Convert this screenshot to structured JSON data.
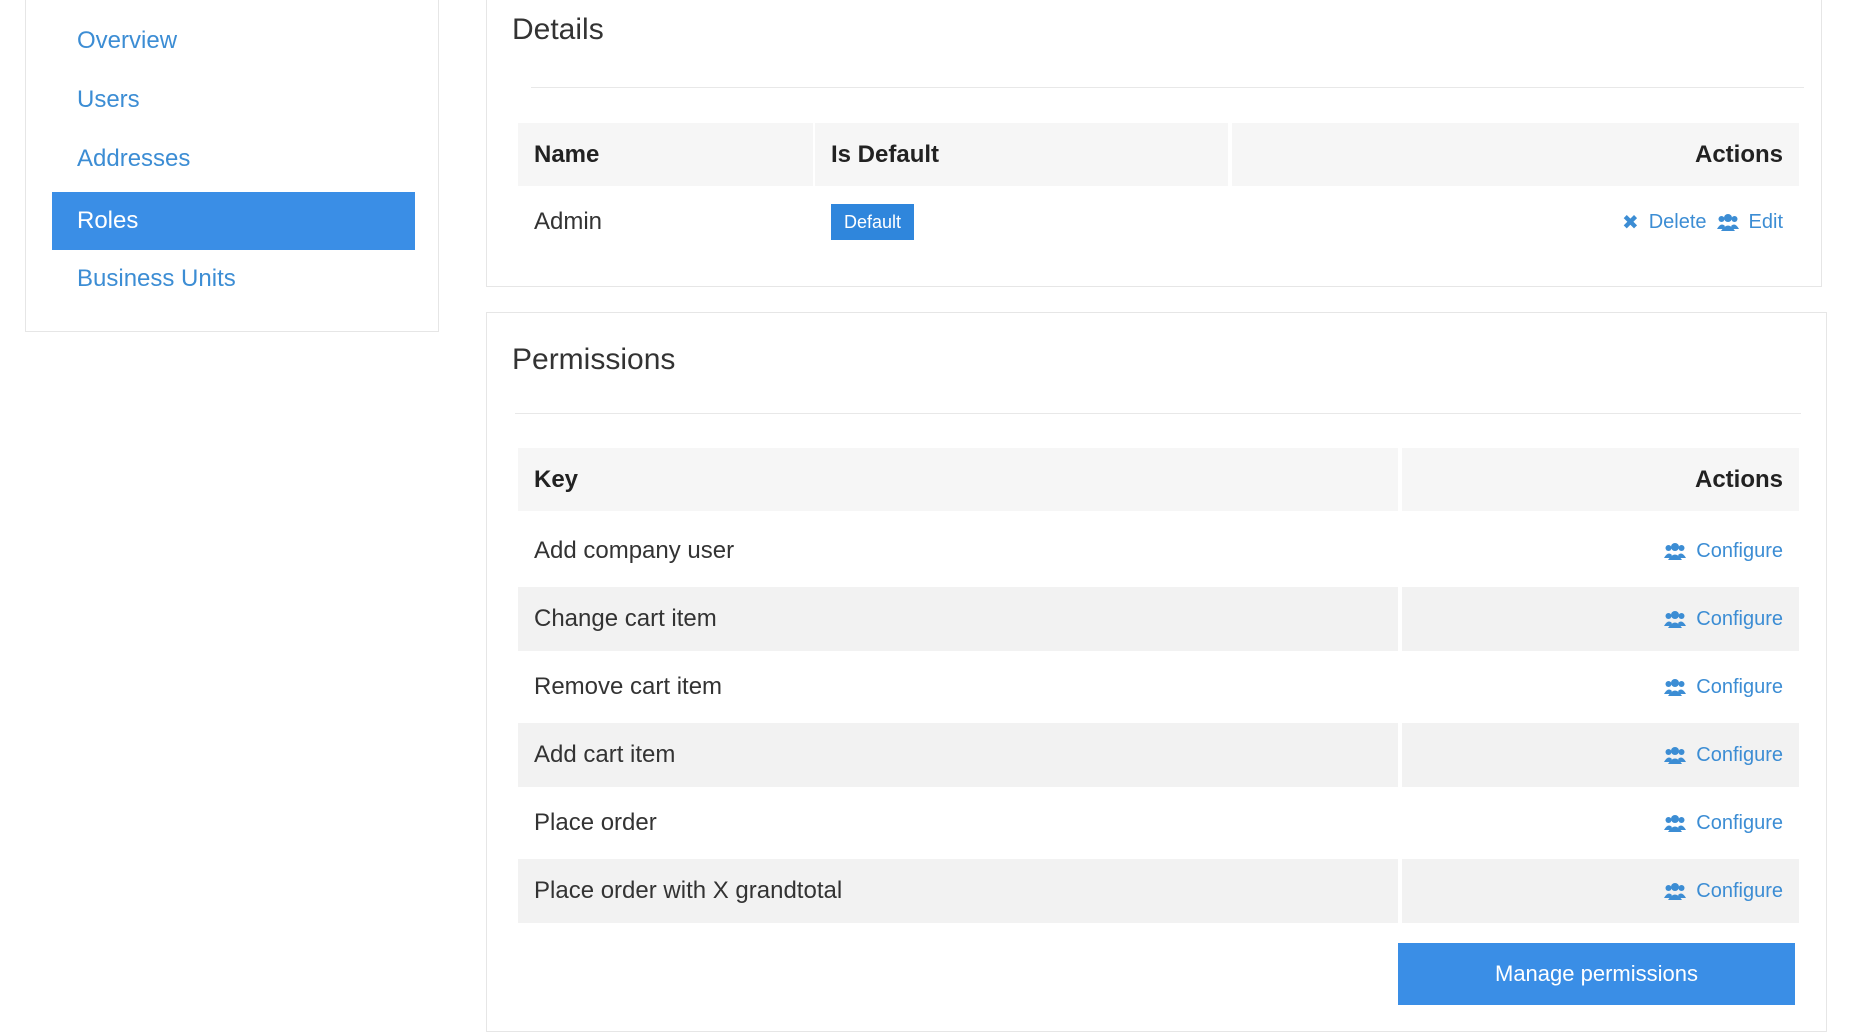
{
  "sidebar": {
    "items": [
      {
        "label": "Overview"
      },
      {
        "label": "Users"
      },
      {
        "label": "Addresses"
      },
      {
        "label": "Roles",
        "active": true
      },
      {
        "label": "Business Units"
      }
    ]
  },
  "details": {
    "title": "Details",
    "columns": {
      "name": "Name",
      "is_default": "Is Default",
      "actions": "Actions"
    },
    "row": {
      "name": "Admin",
      "badge": "Default",
      "delete_label": "Delete",
      "edit_label": "Edit",
      "delete_icon": "close-icon",
      "edit_icon": "users-icon"
    }
  },
  "permissions": {
    "title": "Permissions",
    "columns": {
      "key": "Key",
      "actions": "Actions"
    },
    "configure_label": "Configure",
    "configure_icon": "users-icon",
    "rows": [
      {
        "key": "Add company user"
      },
      {
        "key": "Change cart item"
      },
      {
        "key": "Remove cart item"
      },
      {
        "key": "Add cart item"
      },
      {
        "key": "Place order"
      },
      {
        "key": "Place order with X grandtotal"
      }
    ],
    "manage_button": "Manage permissions"
  },
  "colors": {
    "accent": "#3a8ee6",
    "link": "#3c8dd4",
    "row_stripe": "#f2f2f2"
  }
}
